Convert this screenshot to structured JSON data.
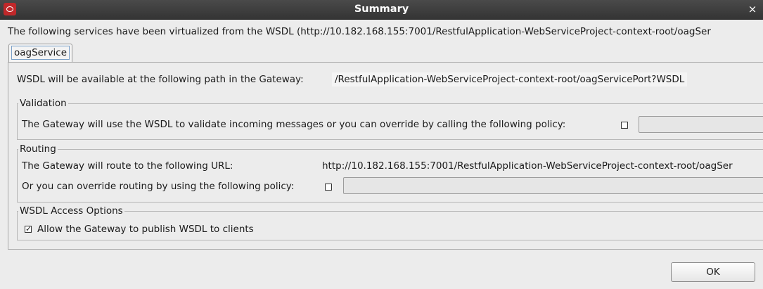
{
  "window": {
    "title": "Summary",
    "close_glyph": "×",
    "app_icon": "oracle-icon"
  },
  "intro_text": "The following services have been virtualized from the WSDL (http://10.182.168.155:7001/RestfulApplication-WebServiceProject-context-root/oagSer",
  "tabs": [
    {
      "label": "oagService"
    }
  ],
  "wsdl_path": {
    "label": "WSDL will be available at the following path in the Gateway:",
    "value": "/RestfulApplication-WebServiceProject-context-root/oagServicePort?WSDL"
  },
  "validation": {
    "legend": "Validation",
    "text": "The Gateway will use the WSDL to validate incoming messages or you can override by calling the following policy:",
    "checked": false,
    "policy_value": ""
  },
  "routing": {
    "legend": "Routing",
    "url_label": "The Gateway will route to the following URL:",
    "url_value": "http://10.182.168.155:7001/RestfulApplication-WebServiceProject-context-root/oagSer",
    "override_label": "Or you can override routing by using the following policy:",
    "checked": false,
    "policy_value": ""
  },
  "wsdl_access": {
    "legend": "WSDL Access Options",
    "publish_label": "Allow the Gateway to publish WSDL to clients",
    "checked": true,
    "check_glyph": "✓"
  },
  "buttons": {
    "ok_label": "OK"
  }
}
